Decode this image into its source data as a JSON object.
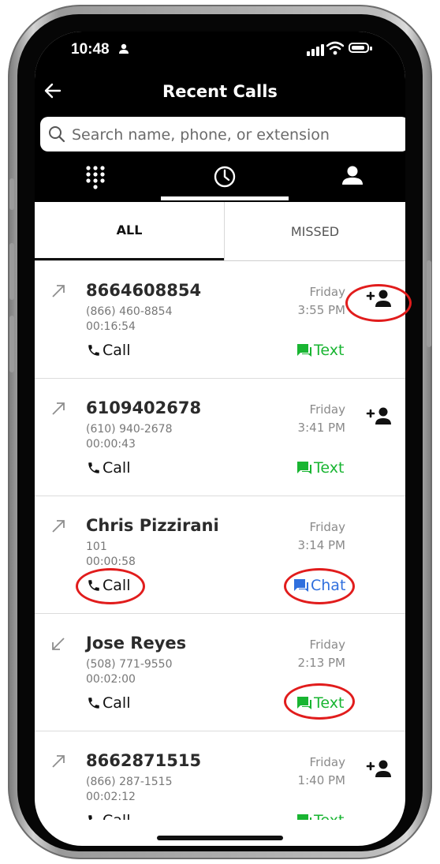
{
  "status_bar": {
    "time": "10:48"
  },
  "header": {
    "title": "Recent Calls"
  },
  "search": {
    "placeholder": "Search name, phone, or extension"
  },
  "nav_tabs": [
    "dialpad",
    "recent",
    "contacts"
  ],
  "filter_tabs": {
    "all": "ALL",
    "missed": "MISSED"
  },
  "labels": {
    "call": "Call",
    "text": "Text",
    "chat": "Chat"
  },
  "calls": [
    {
      "name": "8664608854",
      "line1": "(866) 460-8854",
      "line2": "00:16:54",
      "day": "Friday",
      "time": "3:55 PM",
      "direction": "outgoing",
      "message_action": "text",
      "add_contact": true
    },
    {
      "name": "6109402678",
      "line1": "(610) 940-2678",
      "line2": "00:00:43",
      "day": "Friday",
      "time": "3:41 PM",
      "direction": "outgoing",
      "message_action": "text",
      "add_contact": true
    },
    {
      "name": "Chris Pizzirani",
      "line1": "101",
      "line2": "00:00:58",
      "day": "Friday",
      "time": "3:14 PM",
      "direction": "outgoing",
      "message_action": "chat",
      "add_contact": false
    },
    {
      "name": "Jose Reyes",
      "line1": "(508) 771-9550",
      "line2": "00:02:00",
      "day": "Friday",
      "time": "2:13 PM",
      "direction": "incoming",
      "message_action": "text",
      "add_contact": false
    },
    {
      "name": "8662871515",
      "line1": "(866) 287-1515",
      "line2": "00:02:12",
      "day": "Friday",
      "time": "1:40 PM",
      "direction": "outgoing",
      "message_action": "text",
      "add_contact": true
    }
  ],
  "colors": {
    "text_action": "#19b532",
    "chat_action": "#2f6fde",
    "highlight_circle": "#e11c1c"
  }
}
